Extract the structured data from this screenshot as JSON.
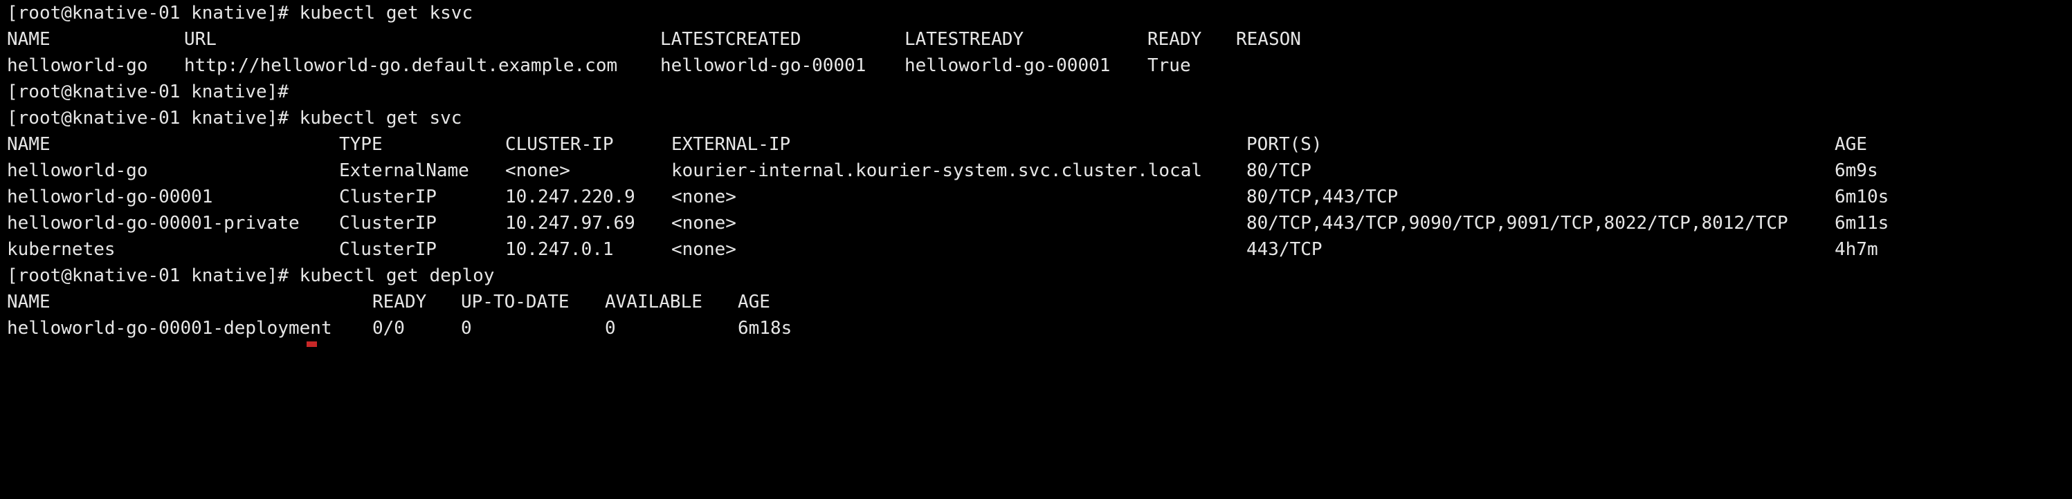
{
  "ksvc": {
    "prompt": "[root@knative-01 knative]# kubectl get ksvc",
    "headers": [
      "NAME",
      "URL",
      "LATESTCREATED",
      "LATESTREADY",
      "READY",
      "REASON"
    ],
    "rows": [
      [
        "helloworld-go",
        "http://helloworld-go.default.example.com",
        "helloworld-go-00001",
        "helloworld-go-00001",
        "True",
        ""
      ]
    ]
  },
  "empty_prompt": "[root@knative-01 knative]#",
  "svc": {
    "prompt": "[root@knative-01 knative]# kubectl get svc",
    "headers": [
      "NAME",
      "TYPE",
      "CLUSTER-IP",
      "EXTERNAL-IP",
      "PORT(S)",
      "AGE"
    ],
    "rows": [
      [
        "helloworld-go",
        "ExternalName",
        "<none>",
        "kourier-internal.kourier-system.svc.cluster.local",
        "80/TCP",
        "6m9s"
      ],
      [
        "helloworld-go-00001",
        "ClusterIP",
        "10.247.220.9",
        "<none>",
        "80/TCP,443/TCP",
        "6m10s"
      ],
      [
        "helloworld-go-00001-private",
        "ClusterIP",
        "10.247.97.69",
        "<none>",
        "80/TCP,443/TCP,9090/TCP,9091/TCP,8022/TCP,8012/TCP",
        "6m11s"
      ],
      [
        "kubernetes",
        "ClusterIP",
        "10.247.0.1",
        "<none>",
        "443/TCP",
        "4h7m"
      ]
    ]
  },
  "deploy": {
    "prompt": "[root@knative-01 knative]# kubectl get deploy",
    "headers": [
      "NAME",
      "READY",
      "UP-TO-DATE",
      "AVAILABLE",
      "AGE"
    ],
    "rows": [
      [
        "helloworld-go-00001-deployment",
        "0/0",
        "0",
        "0",
        "6m18s"
      ]
    ]
  },
  "colors": {
    "background": "#000000",
    "foreground": "#e6e6e6",
    "cursor": "#c82828"
  }
}
